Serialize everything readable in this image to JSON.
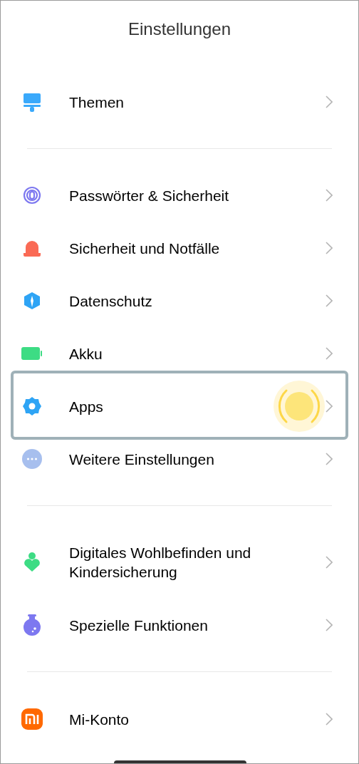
{
  "header": {
    "title": "Einstellungen"
  },
  "sections": [
    {
      "items": [
        {
          "label": "Themen",
          "selected": false
        }
      ]
    },
    {
      "items": [
        {
          "label": "Passwörter & Sicherheit",
          "selected": false
        },
        {
          "label": "Sicherheit und Notfälle",
          "selected": false
        },
        {
          "label": "Datenschutz",
          "selected": false
        },
        {
          "label": "Akku",
          "selected": false
        },
        {
          "label": "Apps",
          "selected": true
        },
        {
          "label": "Weitere Einstellungen",
          "selected": false
        }
      ]
    },
    {
      "items": [
        {
          "label": "Digitales Wohlbefinden und Kindersicherung",
          "selected": false
        },
        {
          "label": "Spezielle Funktionen",
          "selected": false
        }
      ]
    },
    {
      "items": [
        {
          "label": "Mi-Konto",
          "selected": false
        }
      ]
    }
  ]
}
